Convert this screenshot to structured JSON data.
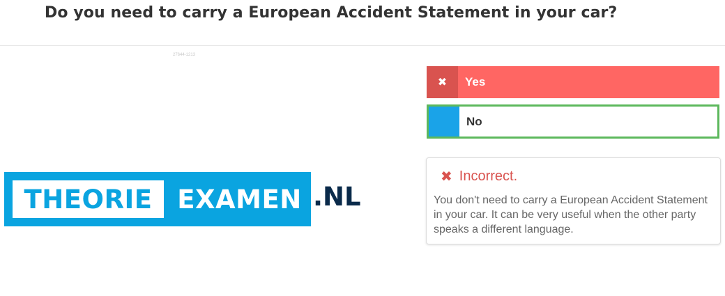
{
  "question": {
    "title": "Do you need to carry a European Accident Statement in your car?"
  },
  "image": {
    "id_text": "27644-1213",
    "logo": {
      "part1": "THEORIE",
      "part2": "EXAMEN",
      "part3": ".NL"
    }
  },
  "answers": [
    {
      "label": "Yes",
      "marker_icon": "close-icon",
      "state": "selected-wrong"
    },
    {
      "label": "No",
      "marker_icon": "",
      "state": "correct"
    }
  ],
  "feedback": {
    "icon": "close-icon",
    "title": "Incorrect.",
    "text": "You don't need to carry a European Accident Statement in your car. It can be very useful when the other party speaks a different language."
  },
  "colors": {
    "wrong": "#ff6663",
    "wrong_marker": "#d9534f",
    "correct_border": "#5cb85c",
    "brand_blue": "#0aa4e0",
    "brand_dark": "#0a2a4a"
  }
}
